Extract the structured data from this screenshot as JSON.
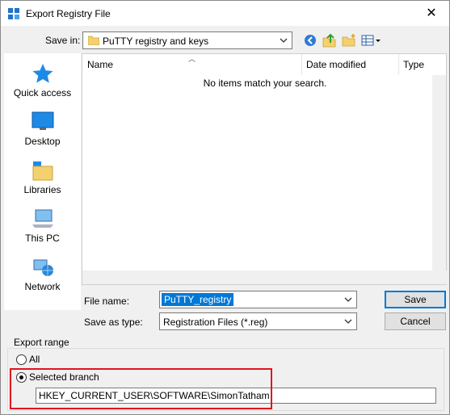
{
  "window": {
    "title": "Export Registry File",
    "close_glyph": "✕"
  },
  "save_in": {
    "label": "Save in:",
    "value": "PuTTY registry and keys"
  },
  "toolbar": {
    "icons": [
      "back-icon",
      "up-folder-icon",
      "new-folder-icon",
      "view-menu-icon"
    ]
  },
  "places": [
    {
      "label": "Quick access",
      "icon": "quick-access-star-icon"
    },
    {
      "label": "Desktop",
      "icon": "desktop-icon"
    },
    {
      "label": "Libraries",
      "icon": "libraries-icon"
    },
    {
      "label": "This PC",
      "icon": "this-pc-icon"
    },
    {
      "label": "Network",
      "icon": "network-icon"
    }
  ],
  "file_list": {
    "columns": [
      "Name",
      "Date modified",
      "Type"
    ],
    "empty_message": "No items match your search."
  },
  "file_name": {
    "label": "File name:",
    "value": "PuTTY_registry"
  },
  "save_type": {
    "label": "Save as type:",
    "value": "Registration Files (*.reg)"
  },
  "buttons": {
    "save": "Save",
    "cancel": "Cancel"
  },
  "export_range": {
    "title": "Export range",
    "all_label": "All",
    "selected_label": "Selected branch",
    "selected": "Selected branch",
    "branch_path": "HKEY_CURRENT_USER\\SOFTWARE\\SimonTatham"
  },
  "colors": {
    "accent": "#0078d7",
    "highlight": "#e0141e"
  }
}
